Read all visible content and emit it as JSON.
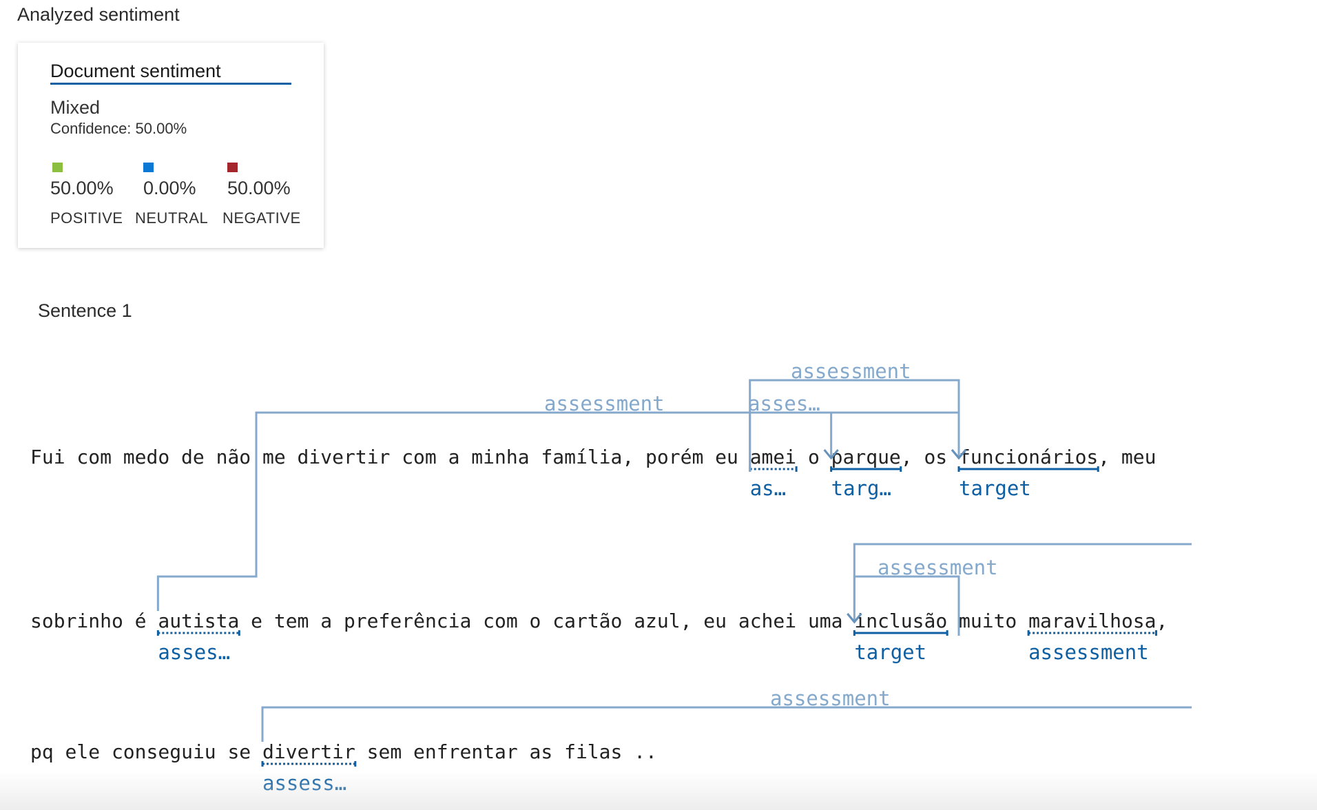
{
  "section_title": "Analyzed sentiment",
  "document": {
    "title": "Document sentiment",
    "overall": "Mixed",
    "confidence": "Confidence: 50.00%",
    "scores": [
      {
        "pct": "50.00%",
        "label": "POSITIVE",
        "color": "#8cbf3f",
        "fraction": 0.5
      },
      {
        "pct": "0.00%",
        "label": "NEUTRAL",
        "color": "#0a78d4",
        "fraction": 0.0
      },
      {
        "pct": "50.00%",
        "label": "NEGATIVE",
        "color": "#a4262c",
        "fraction": 0.5
      }
    ]
  },
  "sentence_title": "Sentence 1",
  "colors": {
    "accent": "#0f5fa3",
    "arc": "#84a9cc",
    "text": "#222222"
  },
  "lines": [
    {
      "tokens": [
        {
          "t": "Fui"
        },
        {
          "t": "com"
        },
        {
          "t": "medo"
        },
        {
          "t": "de"
        },
        {
          "t": "não"
        },
        {
          "t": "me"
        },
        {
          "t": "divertir"
        },
        {
          "t": "com"
        },
        {
          "t": "a"
        },
        {
          "t": "minha"
        },
        {
          "t": "família,"
        },
        {
          "t": "porém"
        },
        {
          "t": "eu"
        },
        {
          "t": "amei",
          "role": "assessment",
          "role_label": "as…"
        },
        {
          "t": "o"
        },
        {
          "t": "parque",
          "suffix": ",",
          "role": "target",
          "role_label": "targ…"
        },
        {
          "t": "os"
        },
        {
          "t": "funcionários",
          "suffix": ",",
          "role": "target",
          "role_label": "target"
        },
        {
          "t": "meu"
        }
      ]
    },
    {
      "tokens": [
        {
          "t": "sobrinho"
        },
        {
          "t": "é"
        },
        {
          "t": "autista",
          "role": "assessment",
          "role_label": "asses…"
        },
        {
          "t": "e"
        },
        {
          "t": "tem"
        },
        {
          "t": "a"
        },
        {
          "t": "preferência"
        },
        {
          "t": "com"
        },
        {
          "t": "o"
        },
        {
          "t": "cartão"
        },
        {
          "t": "azul,"
        },
        {
          "t": "eu"
        },
        {
          "t": "achei"
        },
        {
          "t": "uma"
        },
        {
          "t": "inclusão",
          "role": "target",
          "role_label": "target"
        },
        {
          "t": "muito"
        },
        {
          "t": "maravilhosa",
          "suffix": ",",
          "role": "assessment",
          "role_label": "assessment"
        }
      ]
    },
    {
      "tokens": [
        {
          "t": "pq"
        },
        {
          "t": "ele"
        },
        {
          "t": "conseguiu"
        },
        {
          "t": "se"
        },
        {
          "t": "divertir",
          "role": "assessment",
          "role_label": "assess…"
        },
        {
          "t": "sem"
        },
        {
          "t": "enfrentar"
        },
        {
          "t": "as"
        },
        {
          "t": "filas"
        },
        {
          "t": ".."
        }
      ]
    }
  ],
  "arcs": [
    {
      "from": [
        0,
        13
      ],
      "to": [
        0,
        17
      ],
      "label": "assessment"
    },
    {
      "from": [
        1,
        2
      ],
      "to": [
        0,
        17
      ],
      "label": "assessment"
    },
    {
      "from": [
        0,
        13
      ],
      "to": [
        0,
        15
      ],
      "label": "asses…"
    },
    {
      "from": [
        1,
        15
      ],
      "to": [
        1,
        14
      ],
      "label": "assessment"
    },
    {
      "from": [
        1,
        14
      ],
      "to": "offscreen",
      "label": ""
    },
    {
      "from": [
        2,
        4
      ],
      "to": "offscreen",
      "label": "assessment"
    }
  ]
}
